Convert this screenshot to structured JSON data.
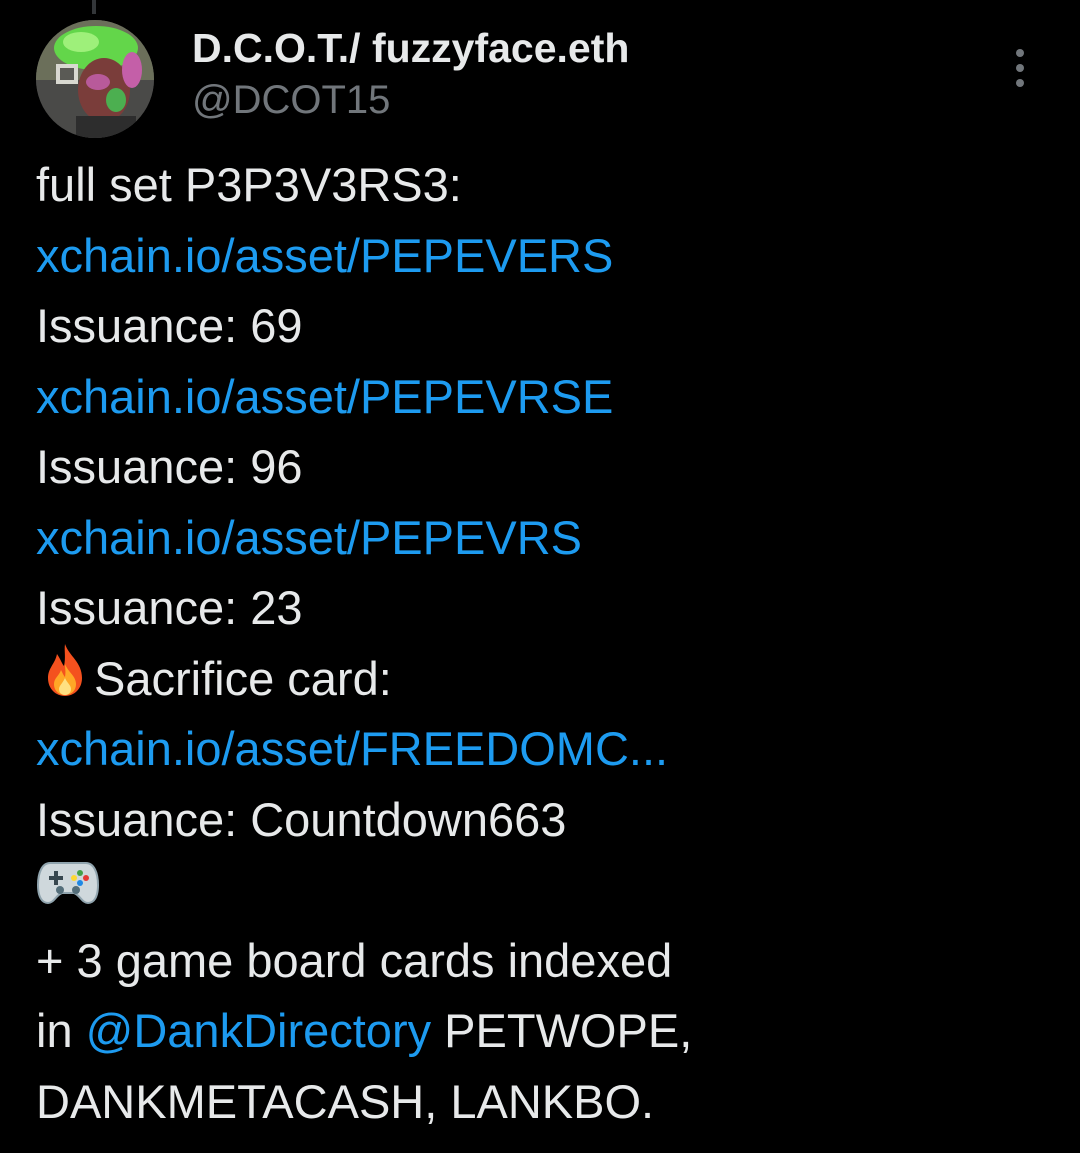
{
  "tweet": {
    "author": {
      "display_name": "D.C.O.T./ fuzzyface.eth",
      "handle": "@DCOT15"
    },
    "lines": {
      "l1": "full set P3P3V3RS3:",
      "link1": "xchain.io/asset/PEPEVERS",
      "issuance1": "Issuance: 69",
      "link2": "xchain.io/asset/PEPEVRSE",
      "issuance2": "Issuance: 96",
      "link3": "xchain.io/asset/PEPEVRS",
      "issuance3": "Issuance: 23",
      "sacrifice": "Sacrifice card:",
      "link4": "xchain.io/asset/FREEDOMC...",
      "issuance4": "Issuance: Countdown663",
      "gameboard": "+ 3  game board cards indexed",
      "in_prefix": "in ",
      "mention": "@DankDirectory",
      "in_suffix": " PETWOPE,",
      "last": "DANKMETACASH, LANKBO."
    },
    "emojis": {
      "fire": "fire-emoji",
      "gamepad": "video-game-emoji"
    },
    "colors": {
      "background": "#000000",
      "text": "#e7e9ea",
      "secondary": "#71767b",
      "link": "#1d9bf0"
    }
  }
}
